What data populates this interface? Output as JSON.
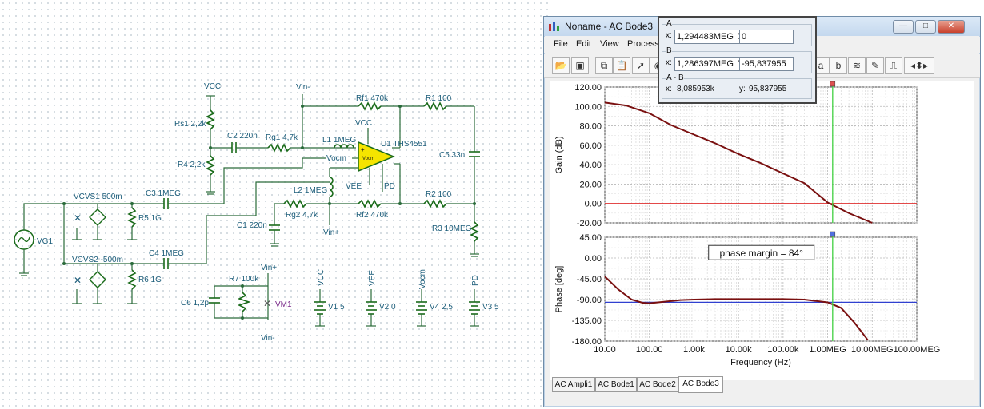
{
  "schematic": {
    "labels": {
      "vcc_top": "VCC",
      "vin_minus_top": "Vin-",
      "rs1": "Rs1 2,2k",
      "c2": "C2 220n",
      "rg1": "Rg1 4,7k",
      "rf1": "Rf1 470k",
      "r1": "R1 100",
      "l1": "L1 1MEG",
      "vcc_amp": "VCC",
      "u1": "U1 THS4551",
      "vocm": "Vocm",
      "vee": "VEE",
      "pd": "PD",
      "r4": "R4 2,2k",
      "c5": "C5 33n",
      "l2": "L2 1MEG",
      "r2": "R2 100",
      "vcvs1": "VCVS1 500m",
      "c3": "C3 1MEG",
      "r5": "R5 1G",
      "rg2": "Rg2 4,7k",
      "rf2": "Rf2 470k",
      "c1": "C1 220n",
      "vin_plus": "Vin+",
      "r3": "R3 10MEG",
      "vg1": "VG1",
      "vcvs2": "VCVS2 -500m",
      "c4": "C4 1MEG",
      "r6": "R6 1G",
      "vin_plus2": "Vin+",
      "r7": "R7 100k",
      "c6": "C6 1,2p",
      "vm1": "VM1",
      "vin_minus2": "Vin-",
      "v1_net": "VCC",
      "v1": "V1 5",
      "v2_net": "VEE",
      "v2": "V2 0",
      "v4_net": "Vocm",
      "v4": "V4 2,5",
      "v3_net": "PD",
      "v3": "V3 5"
    }
  },
  "window": {
    "title": "Noname - AC Bode3",
    "menu": [
      "File",
      "Edit",
      "View",
      "Process"
    ],
    "controls": {
      "minimize": "—",
      "maximize": "□",
      "close": "✕"
    },
    "toolbar_icons": [
      "open-icon",
      "save-icon",
      "copy-icon",
      "paste-icon",
      "pointer-icon",
      "circle-icon"
    ]
  },
  "cursor_panel": {
    "a_label": "A",
    "b_label": "B",
    "ab_label": "A - B",
    "x_label": "x:",
    "y_label": "y:",
    "a_x": "1,294483MEG",
    "a_y": "0",
    "b_x": "1,286397MEG",
    "b_y": "-95,837955",
    "ab_x": "8,085953k",
    "ab_y": "95,837955"
  },
  "tabs": [
    "AC Ampli1",
    "AC Bode1",
    "AC Bode2",
    "AC Bode3"
  ],
  "active_tab": "AC Bode3",
  "chart_data": [
    {
      "type": "line",
      "xlabel": "",
      "ylabel": "Gain (dB)",
      "xscale": "log",
      "xlim": [
        10,
        100000000
      ],
      "ylim": [
        -20,
        120
      ],
      "y_ticks": [
        "120.00",
        "100.00",
        "80.00",
        "60.00",
        "40.00",
        "20.00",
        "0.00",
        "-20.00"
      ],
      "grid": true,
      "series": [
        {
          "x": [
            10,
            30,
            100,
            300,
            1000,
            3000,
            10000,
            30000,
            100000,
            300000,
            1000000,
            3000000,
            10000000
          ],
          "y": [
            104,
            101,
            93,
            81,
            71,
            62,
            51,
            42,
            31,
            21,
            1,
            -10,
            -20
          ],
          "color": "#7a1010"
        }
      ],
      "hlines": [
        {
          "y": 0,
          "color": "#e03030"
        }
      ],
      "vline": {
        "x": 1294483,
        "color": "#40d040"
      }
    },
    {
      "type": "line",
      "xlabel": "Frequency (Hz)",
      "ylabel": "Phase [deg]",
      "xscale": "log",
      "xlim": [
        10,
        100000000
      ],
      "ylim": [
        -180,
        45
      ],
      "y_ticks": [
        "45.00",
        "0.00",
        "-45.00",
        "-90.00",
        "-135.00",
        "-180.00"
      ],
      "x_ticks": [
        "10.00",
        "100.00",
        "1.00k",
        "10.00k",
        "100.00k",
        "1.00MEG",
        "10.00MEG",
        "100.00MEG"
      ],
      "grid": true,
      "series": [
        {
          "x": [
            10,
            20,
            40,
            70,
            100,
            200,
            500,
            1000,
            3000,
            10000,
            30000,
            100000,
            300000,
            1000000,
            2000000,
            4000000,
            8000000
          ],
          "y": [
            -40,
            -68,
            -90,
            -97,
            -98,
            -95,
            -91,
            -90,
            -89,
            -89,
            -89,
            -89,
            -90,
            -96,
            -108,
            -140,
            -178
          ],
          "color": "#7a1010"
        }
      ],
      "hlines": [
        {
          "y": -95.84,
          "color": "#3040d0"
        }
      ],
      "vline": {
        "x": 1294483,
        "color": "#40d040"
      },
      "annotation": "phase margin = 84°"
    }
  ]
}
